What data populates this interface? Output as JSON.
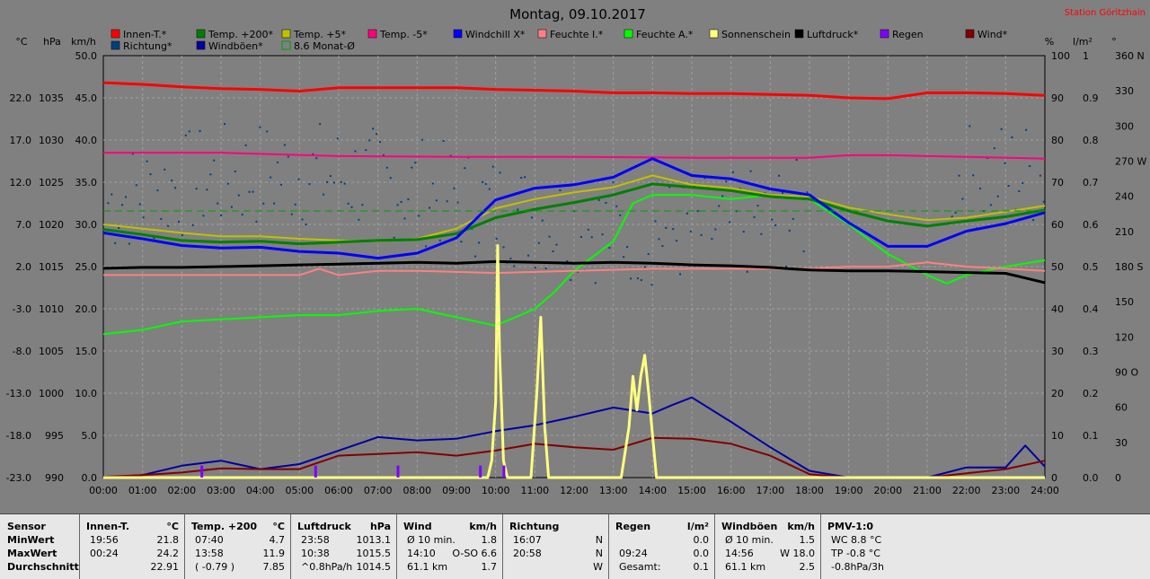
{
  "chart_data": {
    "type": "line",
    "title": "Montag, 09.10.2017",
    "station": "Station Göritzhain",
    "x_ticks": [
      "00:00",
      "01:00",
      "02:00",
      "03:00",
      "04:00",
      "05:00",
      "06:00",
      "07:00",
      "08:00",
      "09:00",
      "10:00",
      "11:00",
      "12:00",
      "13:00",
      "14:00",
      "15:00",
      "16:00",
      "17:00",
      "18:00",
      "19:00",
      "20:00",
      "21:00",
      "22:00",
      "23:00",
      "24:00"
    ],
    "x_range_hours": [
      0,
      24
    ],
    "axes": {
      "temp_c": {
        "unit": "°C",
        "range": [
          -23,
          27
        ],
        "ticks": [
          "-23.0",
          "-18.0",
          "-13.0",
          "-8.0",
          "-3.0",
          "2.0",
          "7.0",
          "12.0",
          "17.0",
          "22.0"
        ]
      },
      "pressure_hpa": {
        "unit": "hPa",
        "range": [
          990,
          1040
        ],
        "ticks": [
          "990",
          "995",
          "1000",
          "1005",
          "1010",
          "1015",
          "1020",
          "1025",
          "1030",
          "1035"
        ]
      },
      "wind_kmh": {
        "unit": "km/h",
        "range": [
          0,
          50
        ],
        "ticks": [
          "0.0",
          "5.0",
          "10.0",
          "15.0",
          "20.0",
          "25.0",
          "30.0",
          "35.0",
          "40.0",
          "45.0",
          "50.0"
        ]
      },
      "humidity_pct": {
        "unit": "%",
        "range": [
          0,
          100
        ],
        "ticks": [
          "0",
          "10",
          "20",
          "30",
          "40",
          "50",
          "60",
          "70",
          "80",
          "90",
          "100"
        ]
      },
      "rain_lm2": {
        "unit": "l/m²",
        "range": [
          0,
          1
        ],
        "ticks": [
          "0.0",
          "0.1",
          "0.2",
          "0.3",
          "0.4",
          "0.5",
          "0.6",
          "0.7",
          "0.8",
          "0.9",
          "1"
        ]
      },
      "direction_deg": {
        "unit": "°",
        "range": [
          0,
          360
        ],
        "ticks": [
          "0",
          "30",
          "60",
          "90 O",
          "120",
          "150",
          "180 S",
          "210",
          "240",
          "270 W",
          "300",
          "330",
          "360 N"
        ]
      }
    },
    "grid": true,
    "legend": [
      {
        "name": "Innen-T.*",
        "color": "#ff0000"
      },
      {
        "name": "Temp. +200*",
        "color": "#008000"
      },
      {
        "name": "Temp. +5*",
        "color": "#c0c000"
      },
      {
        "name": "Temp. -5*",
        "color": "#ff0080"
      },
      {
        "name": "Windchill X*",
        "color": "#0000ff"
      },
      {
        "name": "Feuchte I.*",
        "color": "#ff8080"
      },
      {
        "name": "Feuchte A.*",
        "color": "#00ff00"
      },
      {
        "name": "Sonnenschein",
        "color": "#ffff80"
      },
      {
        "name": "Luftdruck*",
        "color": "#000000"
      },
      {
        "name": "Regen",
        "color": "#8000ff"
      },
      {
        "name": "Wind*",
        "color": "#800000"
      },
      {
        "name": "Richtung*",
        "color": "#004080"
      },
      {
        "name": "Windböen*",
        "color": "#0000a0"
      },
      {
        "name": "8.6 Monat-Ø",
        "color": "#00a000"
      }
    ],
    "series": [
      {
        "name": "Innen-T.*",
        "axis": "temp_c",
        "color": "#ff0000",
        "x": [
          0,
          1,
          2,
          3,
          4,
          5,
          6,
          7,
          8,
          9,
          10,
          11,
          12,
          13,
          14,
          15,
          16,
          17,
          18,
          19,
          20,
          21,
          22,
          23,
          24
        ],
        "y": [
          23.8,
          23.6,
          23.3,
          23.1,
          23.0,
          22.8,
          23.2,
          23.2,
          23.2,
          23.2,
          23.0,
          22.9,
          22.8,
          22.6,
          22.6,
          22.5,
          22.5,
          22.4,
          22.3,
          22.0,
          21.9,
          22.6,
          22.6,
          22.5,
          22.3
        ]
      },
      {
        "name": "Temp. +200*",
        "axis": "temp_c",
        "color": "#008000",
        "x": [
          0,
          1,
          2,
          3,
          4,
          5,
          6,
          7,
          8,
          9,
          10,
          11,
          12,
          13,
          14,
          15,
          16,
          17,
          18,
          19,
          20,
          21,
          22,
          23,
          24
        ],
        "y": [
          6.4,
          5.8,
          5.1,
          4.9,
          5.0,
          4.7,
          4.9,
          5.1,
          5.2,
          5.9,
          7.8,
          8.8,
          9.6,
          10.5,
          11.8,
          11.4,
          11.0,
          10.3,
          10.0,
          8.6,
          7.4,
          6.8,
          7.4,
          7.9,
          8.7
        ]
      },
      {
        "name": "Temp. +5*",
        "axis": "temp_c",
        "color": "#c0c000",
        "x": [
          0,
          1,
          2,
          3,
          4,
          5,
          6,
          7,
          8,
          9,
          10,
          11,
          12,
          13,
          14,
          15,
          16,
          17,
          18,
          19,
          20,
          21,
          22,
          23,
          24
        ],
        "y": [
          7.0,
          6.5,
          6.0,
          5.6,
          5.6,
          5.3,
          5.1,
          5.0,
          5.3,
          6.5,
          8.9,
          10.0,
          10.8,
          11.4,
          12.8,
          11.7,
          11.3,
          10.5,
          10.3,
          9.0,
          8.2,
          7.5,
          7.8,
          8.5,
          9.2
        ]
      },
      {
        "name": "Temp. -5*",
        "axis": "temp_c",
        "color": "#ff0080",
        "x": [
          0,
          3,
          6,
          9,
          12,
          15,
          18,
          19,
          20,
          22,
          24
        ],
        "y": [
          15.5,
          15.5,
          15.1,
          15.0,
          15.0,
          14.9,
          14.9,
          15.2,
          15.2,
          15.0,
          14.8
        ]
      },
      {
        "name": "Windchill X*",
        "axis": "temp_c",
        "color": "#0000ff",
        "x": [
          0,
          1,
          2,
          3,
          4,
          5,
          6,
          7,
          8,
          9,
          10,
          11,
          12,
          13,
          14,
          15,
          16,
          17,
          18,
          19,
          20,
          21,
          22,
          23,
          24
        ],
        "y": [
          6.0,
          5.3,
          4.5,
          4.2,
          4.3,
          3.8,
          3.6,
          3.0,
          3.6,
          5.4,
          9.9,
          11.3,
          11.7,
          12.6,
          14.8,
          12.8,
          12.4,
          11.2,
          10.5,
          7.2,
          4.4,
          4.4,
          6.2,
          7.1,
          8.4
        ]
      },
      {
        "name": "Feuchte I.*",
        "axis": "humidity_pct",
        "color": "#ff8080",
        "x": [
          0,
          2,
          4,
          5,
          5.5,
          6,
          7,
          8,
          10,
          12,
          14,
          16,
          18,
          19,
          20,
          21,
          22,
          24
        ],
        "y": [
          48,
          48,
          48,
          48,
          49.5,
          48,
          49,
          49,
          48.5,
          49,
          49.5,
          49.5,
          49.5,
          50,
          50,
          51,
          50,
          49
        ]
      },
      {
        "name": "Feuchte A.*",
        "axis": "humidity_pct",
        "color": "#00ff00",
        "x": [
          0,
          1,
          2,
          3,
          4,
          5,
          6,
          7,
          8,
          9,
          10,
          11,
          11.5,
          12,
          13,
          13.5,
          14,
          15,
          16,
          17,
          18,
          19,
          20,
          21,
          21.5,
          22,
          23,
          24
        ],
        "y": [
          34,
          35,
          37,
          37.5,
          38,
          38.5,
          38.5,
          39.5,
          40,
          38,
          36,
          40,
          44,
          49,
          56,
          65,
          67,
          67,
          66,
          67,
          66,
          60,
          53,
          48,
          46,
          48,
          50,
          51.5
        ]
      },
      {
        "name": "Luftdruck*",
        "axis": "pressure_hpa",
        "color": "#000000",
        "x": [
          0,
          1,
          2,
          3,
          4,
          5,
          6,
          7,
          8,
          9,
          10,
          11,
          12,
          13,
          14,
          15,
          16,
          17,
          18,
          19,
          20,
          21,
          22,
          23,
          24
        ],
        "y": [
          1014.8,
          1014.9,
          1014.9,
          1015.0,
          1015.1,
          1015.2,
          1015.3,
          1015.4,
          1015.5,
          1015.4,
          1015.6,
          1015.5,
          1015.4,
          1015.5,
          1015.4,
          1015.2,
          1015.1,
          1014.9,
          1014.6,
          1014.5,
          1014.5,
          1014.4,
          1014.3,
          1014.2,
          1013.1
        ]
      },
      {
        "name": "Windböen*",
        "axis": "wind_kmh",
        "color": "#0000a0",
        "x": [
          0,
          1,
          2,
          3,
          4,
          5,
          6,
          7,
          8,
          9,
          10,
          11,
          12,
          13,
          14,
          14.5,
          15,
          16,
          17,
          18,
          19,
          20,
          21,
          22,
          23,
          23.5,
          24
        ],
        "y": [
          0,
          0.3,
          1.4,
          2.0,
          1.0,
          1.6,
          3.2,
          4.8,
          4.4,
          4.6,
          5.5,
          6.2,
          7.2,
          8.3,
          7.6,
          8.6,
          9.5,
          6.6,
          3.6,
          0.8,
          0,
          0,
          0,
          1.2,
          1.2,
          3.8,
          1.3
        ]
      },
      {
        "name": "Wind*",
        "axis": "wind_kmh",
        "color": "#800000",
        "x": [
          0,
          1,
          2,
          3,
          4,
          5,
          6,
          7,
          8,
          9,
          10,
          11,
          12,
          13,
          14,
          15,
          16,
          17,
          18,
          19,
          20,
          21,
          22,
          23,
          24
        ],
        "y": [
          0.1,
          0.3,
          0.6,
          1.1,
          1.0,
          1.0,
          2.6,
          2.8,
          3.0,
          2.6,
          3.2,
          4.0,
          3.6,
          3.3,
          4.7,
          4.6,
          4.0,
          2.6,
          0.4,
          0,
          0,
          0,
          0.5,
          1.0,
          2.0
        ]
      },
      {
        "name": "Sonnenschein",
        "axis": "wind_kmh",
        "color": "#ffff80",
        "x": [
          0,
          9.8,
          9.9,
          10.0,
          10.05,
          10.1,
          10.2,
          10.3,
          10.4,
          10.5,
          10.9,
          11.05,
          11.15,
          11.25,
          11.35,
          11.5,
          13.2,
          13.4,
          13.5,
          13.6,
          13.7,
          13.8,
          13.9,
          14.0,
          14.1,
          14.3,
          24
        ],
        "y": [
          0,
          0,
          2,
          9,
          27.5,
          15,
          2,
          0,
          0,
          0,
          0,
          10,
          19,
          6,
          0,
          0,
          0,
          6,
          12,
          8,
          12,
          14.5,
          10,
          5,
          0,
          0,
          0
        ]
      },
      {
        "name": "Regen",
        "axis": "rain_lm2",
        "color": "#8000ff",
        "x": [
          2.5,
          5.4,
          7.5,
          9.6,
          10.2
        ],
        "y": [
          0.02,
          0.02,
          0.02,
          0.02,
          0.02
        ]
      },
      {
        "name": "8.6 Monat-Ø",
        "axis": "temp_c",
        "color": "#00a000",
        "style": "dashed",
        "x": [
          0,
          24
        ],
        "y": [
          8.6,
          8.6
        ]
      }
    ],
    "annotations": [
      "°C",
      "hPa",
      "km/h",
      "%",
      "l/m²",
      "°"
    ]
  },
  "table": {
    "columns": [
      {
        "header": "Sensor",
        "unit": "",
        "rows": [
          [
            "MinWert",
            ""
          ],
          [
            "MaxWert",
            ""
          ],
          [
            "Durchschnitt",
            ""
          ]
        ]
      },
      {
        "header": "Innen-T.",
        "unit": "°C",
        "rows": [
          [
            "19:56",
            "21.8"
          ],
          [
            "00:24",
            "24.2"
          ],
          [
            "",
            "22.91"
          ]
        ]
      },
      {
        "header": "Temp. +200",
        "unit": "°C",
        "rows": [
          [
            "07:40",
            "4.7"
          ],
          [
            "13:58",
            "11.9"
          ],
          [
            "( -0.79 )",
            "7.85"
          ]
        ]
      },
      {
        "header": "Luftdruck",
        "unit": "hPa",
        "rows": [
          [
            "23:58",
            "1013.1"
          ],
          [
            "10:38",
            "1015.5"
          ],
          [
            "^0.8hPa/h",
            "1014.5"
          ]
        ]
      },
      {
        "header": "Wind",
        "unit": "km/h",
        "rows": [
          [
            "Ø 10 min.",
            "1.8"
          ],
          [
            "14:10",
            "O-SO 6.6"
          ],
          [
            "61.1 km",
            "1.7"
          ]
        ]
      },
      {
        "header": "Richtung",
        "unit": "",
        "rows": [
          [
            "16:07",
            "N"
          ],
          [
            "20:58",
            "N"
          ],
          [
            "",
            "W"
          ]
        ]
      },
      {
        "header": "Regen",
        "unit": "l/m²",
        "rows": [
          [
            "",
            "0.0"
          ],
          [
            "09:24",
            "0.0"
          ],
          [
            "Gesamt:",
            "0.1"
          ]
        ]
      },
      {
        "header": "Windböen",
        "unit": "km/h",
        "rows": [
          [
            "Ø 10 min.",
            "1.5"
          ],
          [
            "14:56",
            "W 18.0"
          ],
          [
            "61.1 km",
            "2.5"
          ]
        ]
      },
      {
        "header": "PMV-1:0",
        "unit": "",
        "rows": [
          [
            "WC 8.8 °C",
            ""
          ],
          [
            "TP -0.8 °C",
            ""
          ],
          [
            "-0.8hPa/3h",
            ""
          ]
        ]
      }
    ]
  }
}
